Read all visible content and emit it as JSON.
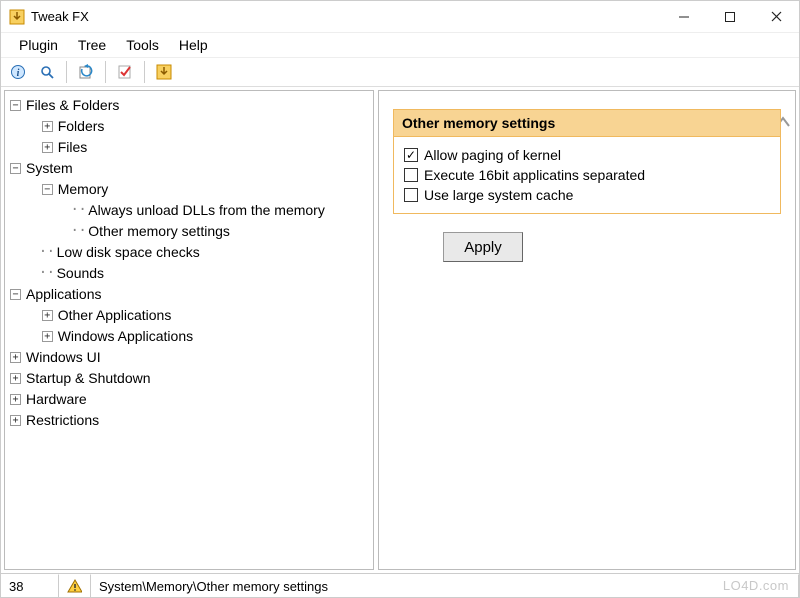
{
  "window": {
    "title": "Tweak FX"
  },
  "menu": {
    "items": [
      "Plugin",
      "Tree",
      "Tools",
      "Help"
    ]
  },
  "toolbar": {
    "buttons": [
      "info",
      "search",
      "refresh",
      "check",
      "download"
    ]
  },
  "tree": [
    {
      "depth": 0,
      "expand": "-",
      "label": "Files & Folders"
    },
    {
      "depth": 1,
      "expand": "+",
      "label": "Folders"
    },
    {
      "depth": 1,
      "expand": "+",
      "label": "Files"
    },
    {
      "depth": 0,
      "expand": "-",
      "label": "System"
    },
    {
      "depth": 1,
      "expand": "-",
      "label": "Memory"
    },
    {
      "depth": 2,
      "expand": "",
      "label": "Always unload DLLs from the memory"
    },
    {
      "depth": 2,
      "expand": "",
      "label": "Other memory settings"
    },
    {
      "depth": 1,
      "expand": "",
      "label": "Low disk space checks"
    },
    {
      "depth": 1,
      "expand": "",
      "label": "Sounds"
    },
    {
      "depth": 0,
      "expand": "-",
      "label": "Applications"
    },
    {
      "depth": 1,
      "expand": "+",
      "label": "Other Applications"
    },
    {
      "depth": 1,
      "expand": "+",
      "label": "Windows Applications"
    },
    {
      "depth": 0,
      "expand": "+",
      "label": "Windows UI"
    },
    {
      "depth": 0,
      "expand": "+",
      "label": "Startup & Shutdown"
    },
    {
      "depth": 0,
      "expand": "+",
      "label": "Hardware"
    },
    {
      "depth": 0,
      "expand": "+",
      "label": "Restrictions"
    }
  ],
  "panel": {
    "title": "Other memory settings",
    "checks": [
      {
        "checked": true,
        "label": "Allow paging of kernel"
      },
      {
        "checked": false,
        "label": "Execute 16bit applicatins separated"
      },
      {
        "checked": false,
        "label": "Use large system cache"
      }
    ],
    "apply": "Apply"
  },
  "status": {
    "count": "38",
    "path": "System\\Memory\\Other memory settings"
  },
  "watermark": "LO4D.com"
}
